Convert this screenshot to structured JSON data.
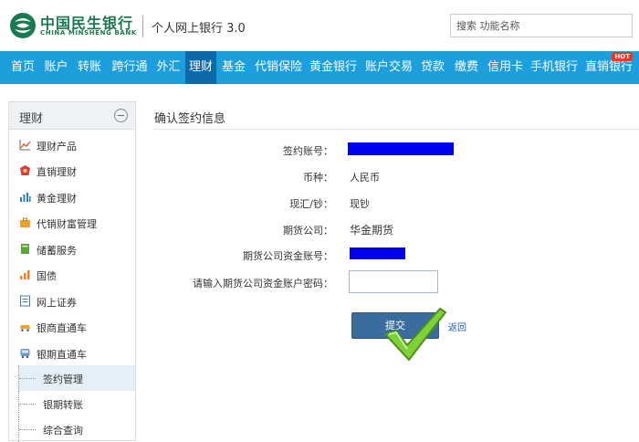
{
  "header": {
    "logo_cn": "中国民生银行",
    "logo_en": "CHINA MINSHENG BANK",
    "site_title": "个人网上银行 3.0",
    "search_placeholder": "搜索 功能名称"
  },
  "nav": {
    "items": [
      "首页",
      "账户",
      "转账",
      "跨行通",
      "外汇",
      "理财",
      "基金",
      "代销保险",
      "黄金银行",
      "账户交易",
      "贷款",
      "缴费",
      "信用卡",
      "手机银行",
      "直销银行"
    ],
    "active": "理财",
    "hot_badge": "HOT"
  },
  "sidebar": {
    "title": "理财",
    "items": [
      {
        "label": "理财产品",
        "icon": "chart-line-icon"
      },
      {
        "label": "直销理财",
        "icon": "shield-badge-icon"
      },
      {
        "label": "黄金理财",
        "icon": "bar-chart-icon"
      },
      {
        "label": "代销财富管理",
        "icon": "briefcase-icon"
      },
      {
        "label": "储蓄服务",
        "icon": "book-icon"
      },
      {
        "label": "国债",
        "icon": "growth-bars-icon"
      },
      {
        "label": "网上证券",
        "icon": "document-icon"
      },
      {
        "label": "银商直通车",
        "icon": "car-icon"
      },
      {
        "label": "银期直通车",
        "icon": "bus-icon"
      }
    ],
    "sub_items": [
      {
        "label": "签约管理",
        "active": true
      },
      {
        "label": "银期转账",
        "active": false
      },
      {
        "label": "综合查询",
        "active": false
      }
    ]
  },
  "main": {
    "title": "确认签约信息",
    "fields": {
      "account_label": "签约账号：",
      "currency_label": "币种：",
      "currency_value": "人民币",
      "cash_label": "现汇/钞：",
      "cash_value": "现钞",
      "company_label": "期货公司：",
      "company_value": "华金期货",
      "fund_account_label": "期货公司资金账号：",
      "password_label": "请输入期货公司资金账户密码："
    },
    "submit_label": "提交",
    "back_label": "返回"
  },
  "colors": {
    "nav_bg": "#1d9fdc",
    "nav_active": "#0c6aa8",
    "brand_green": "#1a7a4f",
    "submit_bg": "#3b6c9e",
    "mask_blue": "#0000ee"
  }
}
